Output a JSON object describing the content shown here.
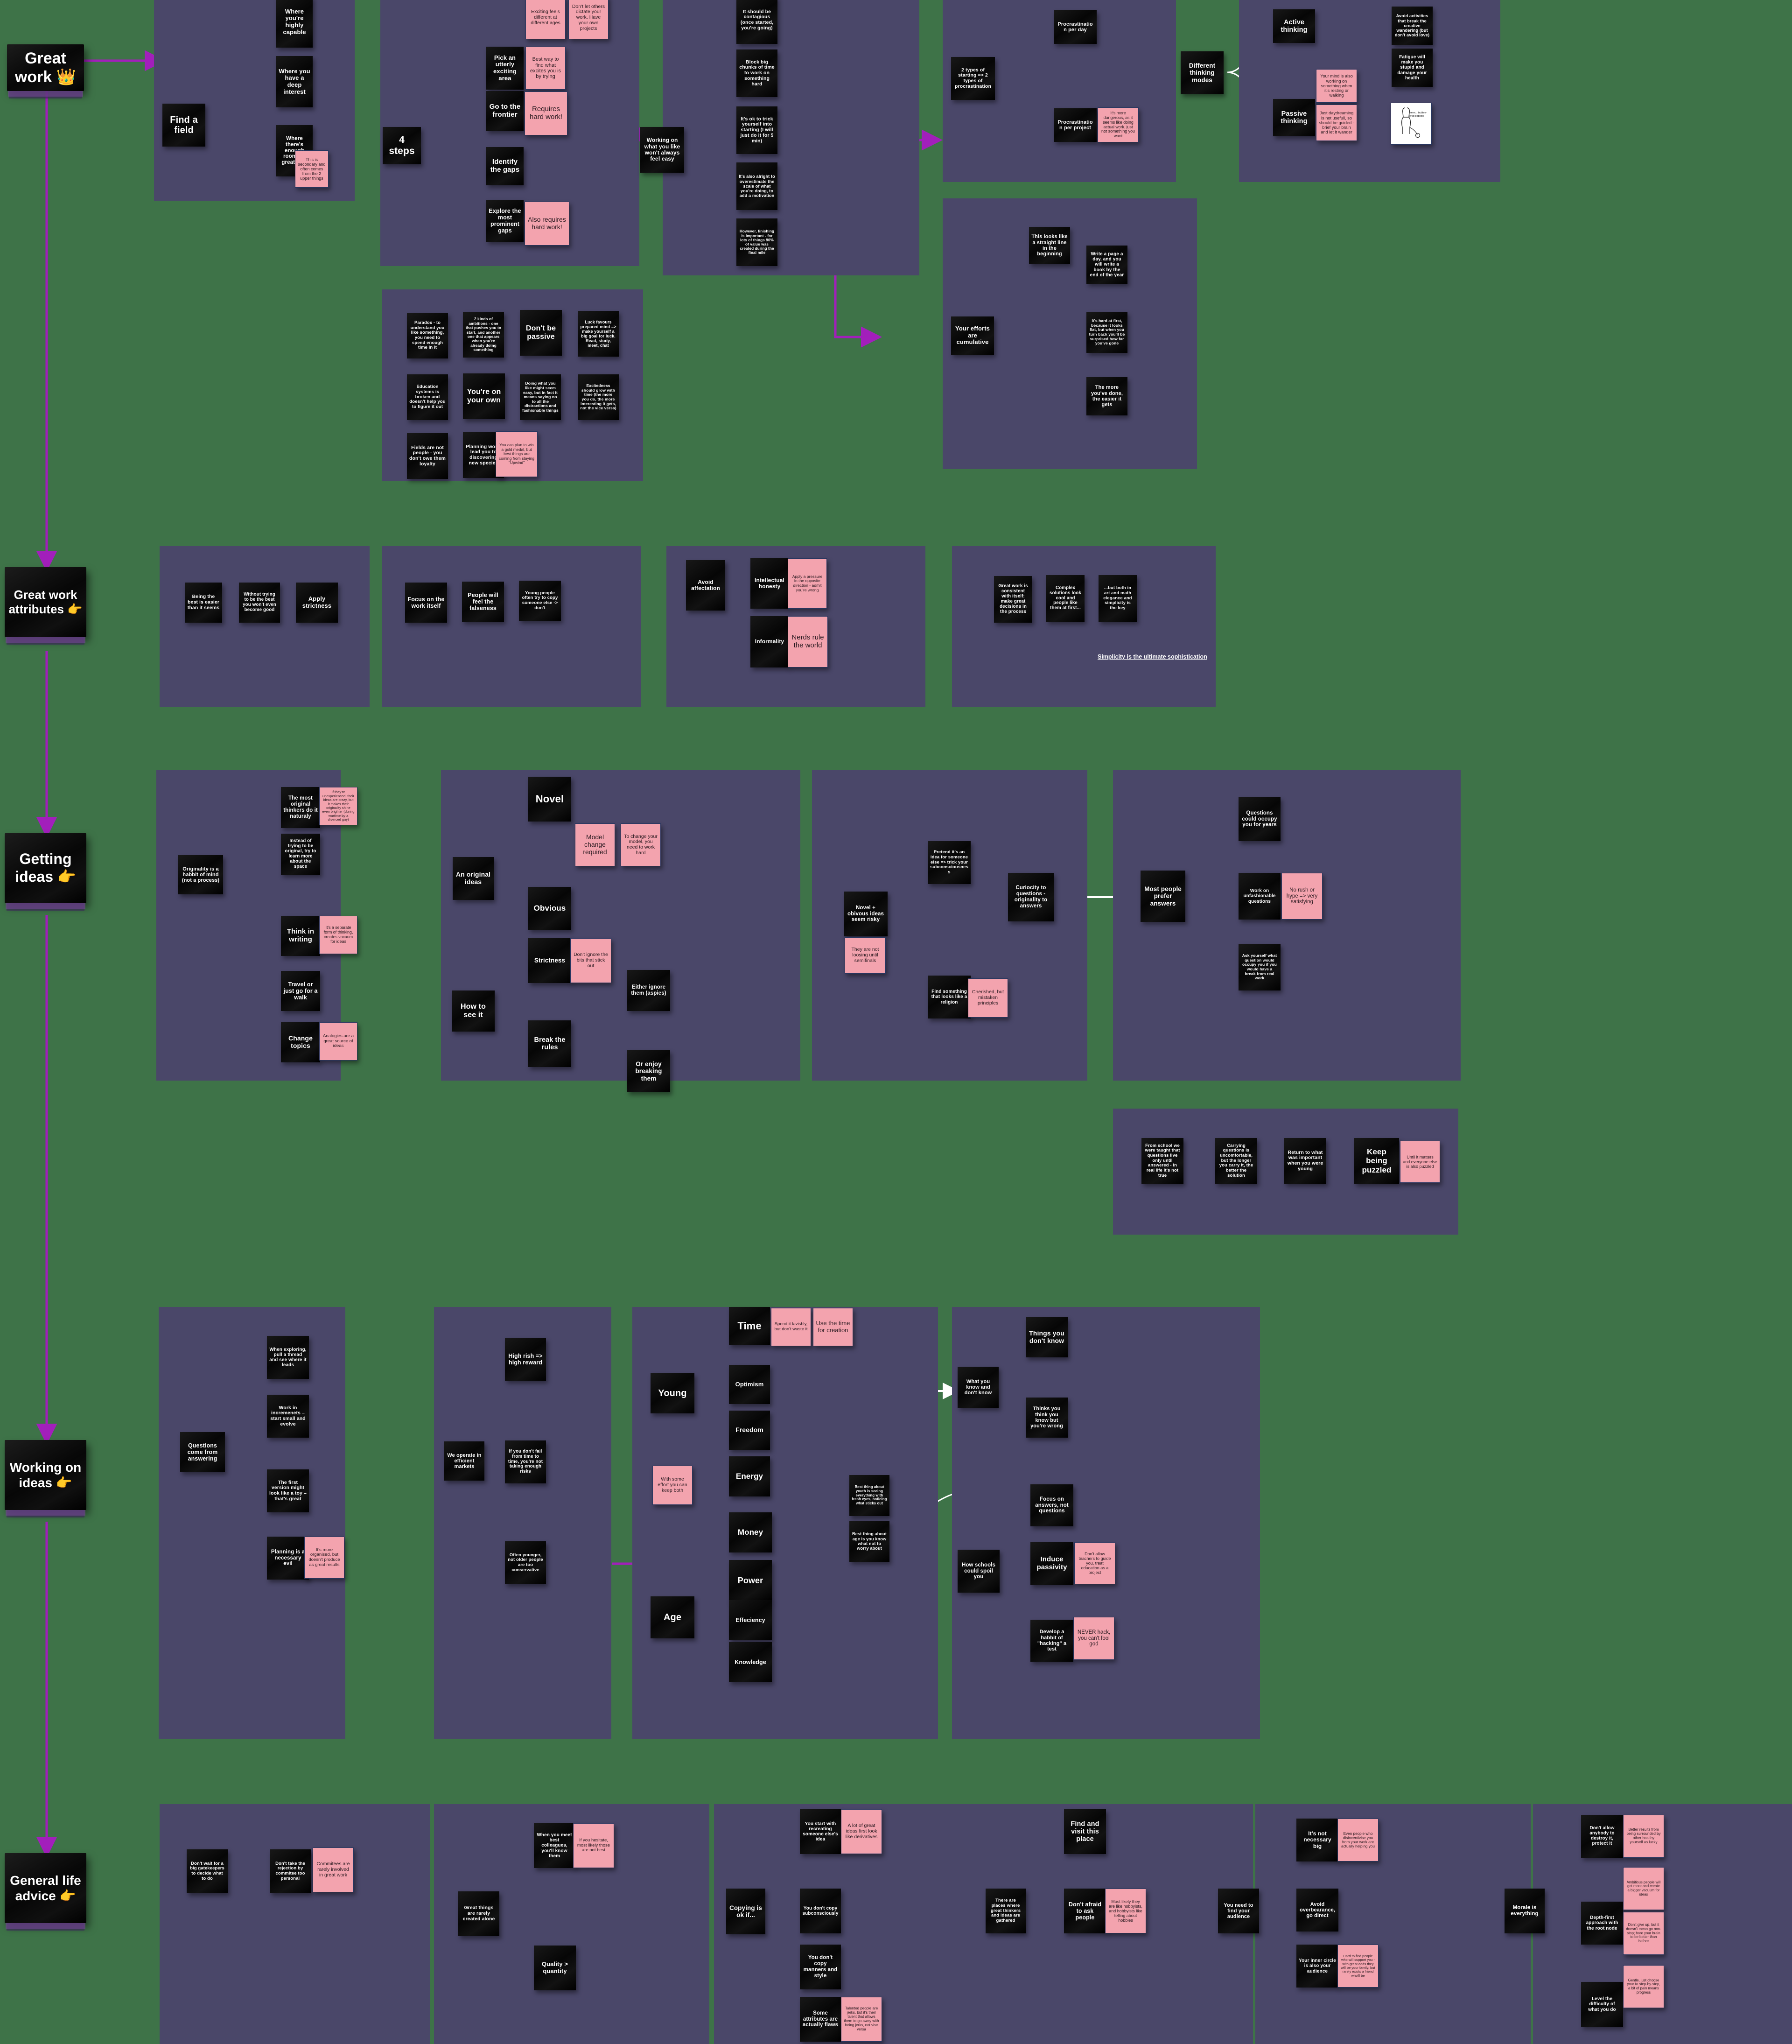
{
  "board": {
    "background_color": "#3e7348",
    "frame_color": "#4a4769",
    "note_black": "#0b0b0b",
    "note_pink": "#f3a3ae",
    "spine_color": "#a21fbb",
    "arrow_color": "#ffffff"
  },
  "spine": [
    {
      "id": "great-work",
      "label": "Great work 👑"
    },
    {
      "id": "great-work-attrs",
      "label": "Great work attributes 👉"
    },
    {
      "id": "getting-ideas",
      "label": "Getting ideas 👉"
    },
    {
      "id": "working-on-ideas",
      "label": "Working on ideas 👉"
    },
    {
      "id": "general-life",
      "label": "General life advice 👉"
    }
  ],
  "sections": {
    "find_a_field": {
      "root": "Find a field",
      "children": [
        "Where you're highly capable",
        "Where you have a deep interest",
        "Where there's enough room for greatness"
      ],
      "note": "This is secondary and often comes from the 2 upper things"
    },
    "four_steps": {
      "root": "4 steps",
      "children": [
        "Pick an utterly exciting area",
        "Go to the frontier",
        "Identify the gaps",
        "Explore the most prominent gaps"
      ],
      "notes": [
        "Exciting feels different at different ages",
        "Don't let others dictate your work. Have your own projects",
        "Best way to find what excites you is by trying",
        "Requires hard work!",
        "Also requires hard work!"
      ]
    },
    "working_on_what_you_like": {
      "root": "Working on what you like won't always feel easy",
      "children": [
        "It should be contagious (once started, you're going)",
        "Block big chunks of time to work on something hard",
        "It's ok to trick yourself into starting (I will just do it for 5 min)",
        "It's also alright to overestimate the scale of what you're doing, to add a motivation",
        "However, finishing is important - for lots of things 90% of value was created during the final mile"
      ]
    },
    "procrastination": {
      "root": "2 types of starting => 2 types of procrastination",
      "children": [
        "Procrastination per day",
        "Procrastination per project"
      ],
      "note": "It's more dangerous, as it seems like doing actual work, just not something you want"
    },
    "thinking_modes": {
      "root": "Different thinking modes",
      "children": [
        "Active thinking",
        "Passive thinking"
      ],
      "pink_notes": [
        "Your mind is also working on something when it's resting or walking",
        "Just daydreaming is not usefull, so should be guided - brief your brain and let it wander"
      ],
      "side_notes": [
        "Avoid activities that break the creative wandering (but don't avoid love)",
        "Fatigue will make you stupid and damage your health"
      ],
      "sketch_caption": "mmm... bubble-wrap popping"
    },
    "cumulative": {
      "root": "Your efforts are cumulative",
      "chart_note": "This looks like a straight line in the beginning",
      "children": [
        "Write a page a day, and you will write a book by the end of the year",
        "It's hard at first, because it looks flat, but when you turn back you'll be surprised how far you've gone",
        "The more you've done, the easier it gets"
      ]
    },
    "misc_grid": [
      "Paradox - to understand you like something, you need to spend enough time in it",
      "2 kinds of ambitions - one that pushes you to start, and another one that appears when you're already doing something",
      "Don't be passive",
      "Luck favours prepared mind => make yourself a big goal for luck. Read, study, meet, chat",
      "Education systems is broken and doesn't help you to figure it out",
      "You're on your own",
      "Doing what you like might seem easy, but in fact it means saying no to all the distractions and fashionable things",
      "Excitedness should grow with time (the more you do, the more interesting it gets, not the vice versa)",
      "Fields are not people - you don't owe them loyalty",
      "Planning won't lead you to discovering new species"
    ],
    "misc_grid_pink": "You can plan to win a gold medal, but best things are coming from staying \"Upwind\"",
    "attributes_row_1": [
      "Being the best is easier than it seems",
      "Without trying to be the best you won't even become good",
      "Apply strictness"
    ],
    "attributes_row_2": [
      "Focus on the work itself",
      "People will feel the falseness",
      "Young people often try to copy someone else -> don't"
    ],
    "affectation": {
      "root": "Avoid affectation",
      "children": [
        "Intellectual honesty",
        "Informality"
      ],
      "pink_notes": [
        "Apply a pressure in the opposite direction - admit you're wrong",
        "Nerds rule the world"
      ]
    },
    "simplicity": {
      "notes": [
        "Great work is consistent with itself: make great decisions in the process",
        "Complex solutions look cool and people like them at first...",
        "...but both in art and math elegance and simplicity is the key"
      ],
      "caption": "Simplicity is the ultimate sophistication"
    },
    "originality": {
      "root": "Originality is a habbit of mind (not a process)",
      "children": [
        "The most original thinkers do it naturaly",
        "Instead of trying to be original, try to learn more about the space",
        "Think in writing",
        "Travel or just go for a walk",
        "Change topics"
      ],
      "pink_notes": [
        "If they're unexperienced, their ideas are crazy, but it makes their originality shine even brighter (during wartime by a diverced guy)",
        "It's a separate form of thinking, creates vacuum for ideas",
        "Analogies are a great source of ideas"
      ]
    },
    "original_ideas": {
      "root": "An original ideas",
      "children": [
        "Novel",
        "Obvious"
      ],
      "pink_notes": [
        "Model change required",
        "To change your model, you need to work hard"
      ]
    },
    "how_to_see_it": {
      "root": "How to see it",
      "children": [
        "Strictness",
        "Break the rules"
      ],
      "grandchildren": [
        "Either ignore them (aspies)",
        "Or enjoy breaking them"
      ],
      "pink_note": "Don't ignore the bits that stick out"
    },
    "novel_obvious_risky": {
      "root": "Novel + obivous ideas seem risky",
      "pink_note": "They are not loosing until semifinals",
      "children": [
        "Pretend it's an idea for someone else => trick your subconsciousness",
        "Find something that looks like a religion"
      ],
      "child_pink": "Cherished, but mistaken principles"
    },
    "curiosity": {
      "root": "Curiocity to questions - originality to answers"
    },
    "prefer_answers": {
      "root": "Most people prefer answers",
      "children": [
        "Questions could occupy you for years",
        "Work on unfashionable questions",
        "Ask yourself what question would occupy you if you would have a break from real work"
      ],
      "pink_note": "No rush or hype => very satisfying"
    },
    "puzzled_row": [
      "From school we were taught that questions live only until answered - in real life it's not true",
      "Carrying questions is uncomfortable, but the longer you carry it, the better the solution",
      "Return to what was important when you were young",
      "Keep being puzzled"
    ],
    "puzzled_pink": "Until it matters and everyone else is also puzzled",
    "questions_answering": {
      "root": "Questions come from answering",
      "children": [
        "When exploring, pull a thread and see where it leads",
        "Work in incremenets – start small and evolve",
        "The first version might look like a toy – that's great",
        "Planning is a necessary evil"
      ],
      "pink_note": "It's more organised, but doesn't produce as great results"
    },
    "markets": {
      "root": "We operate in efficient markets",
      "children": [
        "High rish => high reward",
        "If you don't fail from time to time, you're not taking enough risks",
        "Often younger, not older people are too conservative"
      ]
    },
    "young_age": {
      "young_root": "Young",
      "young_children": [
        "Time",
        "Optimism",
        "Freedom",
        "Energy"
      ],
      "time_pink": [
        "Spend it lavishly, but don't waste it",
        "Use the time for creation"
      ],
      "both_pink": "With some effort you can keep both",
      "age_root": "Age",
      "age_children": [
        "Money",
        "Power",
        "Effeciency",
        "Knowledge"
      ],
      "side_notes": [
        "Best thing about youth is seeing everything with fresh eyes, noticing what sticks out",
        "Best thing about age is you know what not to worry about"
      ]
    },
    "know_dont_know": {
      "root": "What you know and don't know",
      "children": [
        "Things you don't know",
        "Thinks you think you know but you're wrong"
      ]
    },
    "schools_spoil": {
      "root": "How schools could spoil you",
      "children": [
        "Focus on answers, not questions",
        "Induce passivity",
        "Develop a habbit of \"hacking\" a test"
      ],
      "pink_notes": [
        "Don't allow teachers to guide you, treat education as a project",
        "NEVER hack, you can't fool god"
      ]
    },
    "gatekeepers": {
      "notes": [
        "Don't wait for a big gatekeepers to decide what to do",
        "Don't take the rejection by commitee too personal"
      ],
      "pink_note": "Commitees are rarely involved in great work"
    },
    "collaboration": {
      "root": "Great things are rarely created alone",
      "children": [
        "When you meet best colleagues, you'll know them",
        "Quality > quantity"
      ],
      "pink_note": "If you hesitate, most likely those are not best"
    },
    "copying": {
      "root": "Copying is ok if...",
      "children": [
        "You start with recreating someone else's idea",
        "You don't copy subconsciously",
        "You don't copy manners and style",
        "Some attributes are actually flaws"
      ],
      "pink_notes": [
        "A lot of great ideas first look like derivatives",
        "Talented people are jerks, but it's their talent that allows them to go away with being jerks, not vise versa"
      ]
    },
    "places": {
      "root": "There are places where great thinkers and ideas are gathered",
      "children": [
        "Find and visit this place",
        "Don't afraid to ask people"
      ],
      "pink_note": "Most likely they are like hobbyists, and hobbyists like telling about hobbies"
    },
    "audience": {
      "root": "You need to find your audience",
      "children": [
        "It's not necessary big",
        "Avoid overbearance, go direct",
        "Your inner circle is also your audience"
      ],
      "pink_notes": [
        "Even people who disincentivise you from your work are actually helping you",
        "Hard to find people who will support you - with great odds they will be your family, but rarely exists a friend who'll be"
      ]
    },
    "morale": {
      "root": "Morale is everything",
      "children": [
        "Don't allow anybody to destroy it, protect it",
        "Depth-first approach with the root node",
        "Level the difficulty of what you do"
      ],
      "pink_notes": [
        "Better results from being surrounded by other healthy yourself as lucky",
        "Ambitious people will get more and create a bigger vacuum for ideas",
        "Don't give up, but it doesn't mean go non-stop; bore your brain to be better than before",
        "Gentle, just choose your to step-by-step, a bit of pain means progress"
      ]
    }
  }
}
